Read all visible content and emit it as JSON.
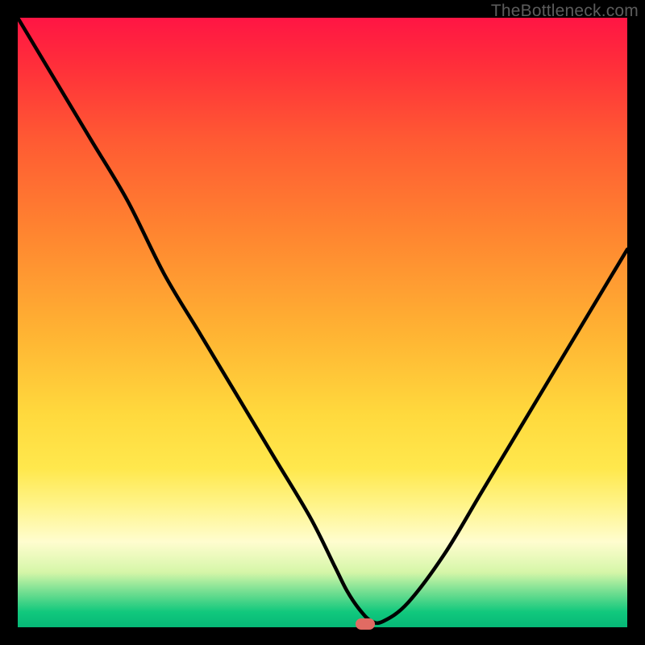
{
  "watermark": "TheBottleneck.com",
  "colors": {
    "frame_bg": "#000000",
    "curve_stroke": "#000000",
    "marker_fill": "#e16b63"
  },
  "chart_data": {
    "type": "line",
    "title": "",
    "xlabel": "",
    "ylabel": "",
    "xlim": [
      0,
      100
    ],
    "ylim": [
      0,
      100
    ],
    "grid": false,
    "legend": false,
    "series": [
      {
        "name": "bottleneck-curve",
        "x": [
          0,
          6,
          12,
          18,
          24,
          30,
          36,
          42,
          48,
          52,
          54,
          56,
          58,
          60,
          64,
          70,
          76,
          82,
          88,
          94,
          100
        ],
        "y": [
          100,
          90,
          80,
          70,
          58,
          48,
          38,
          28,
          18,
          10,
          6,
          3,
          1,
          1,
          4,
          12,
          22,
          32,
          42,
          52,
          62
        ]
      }
    ],
    "annotations": [
      {
        "type": "marker",
        "x": 57,
        "y": 0.5,
        "shape": "pill",
        "color": "#e16b63"
      }
    ]
  }
}
